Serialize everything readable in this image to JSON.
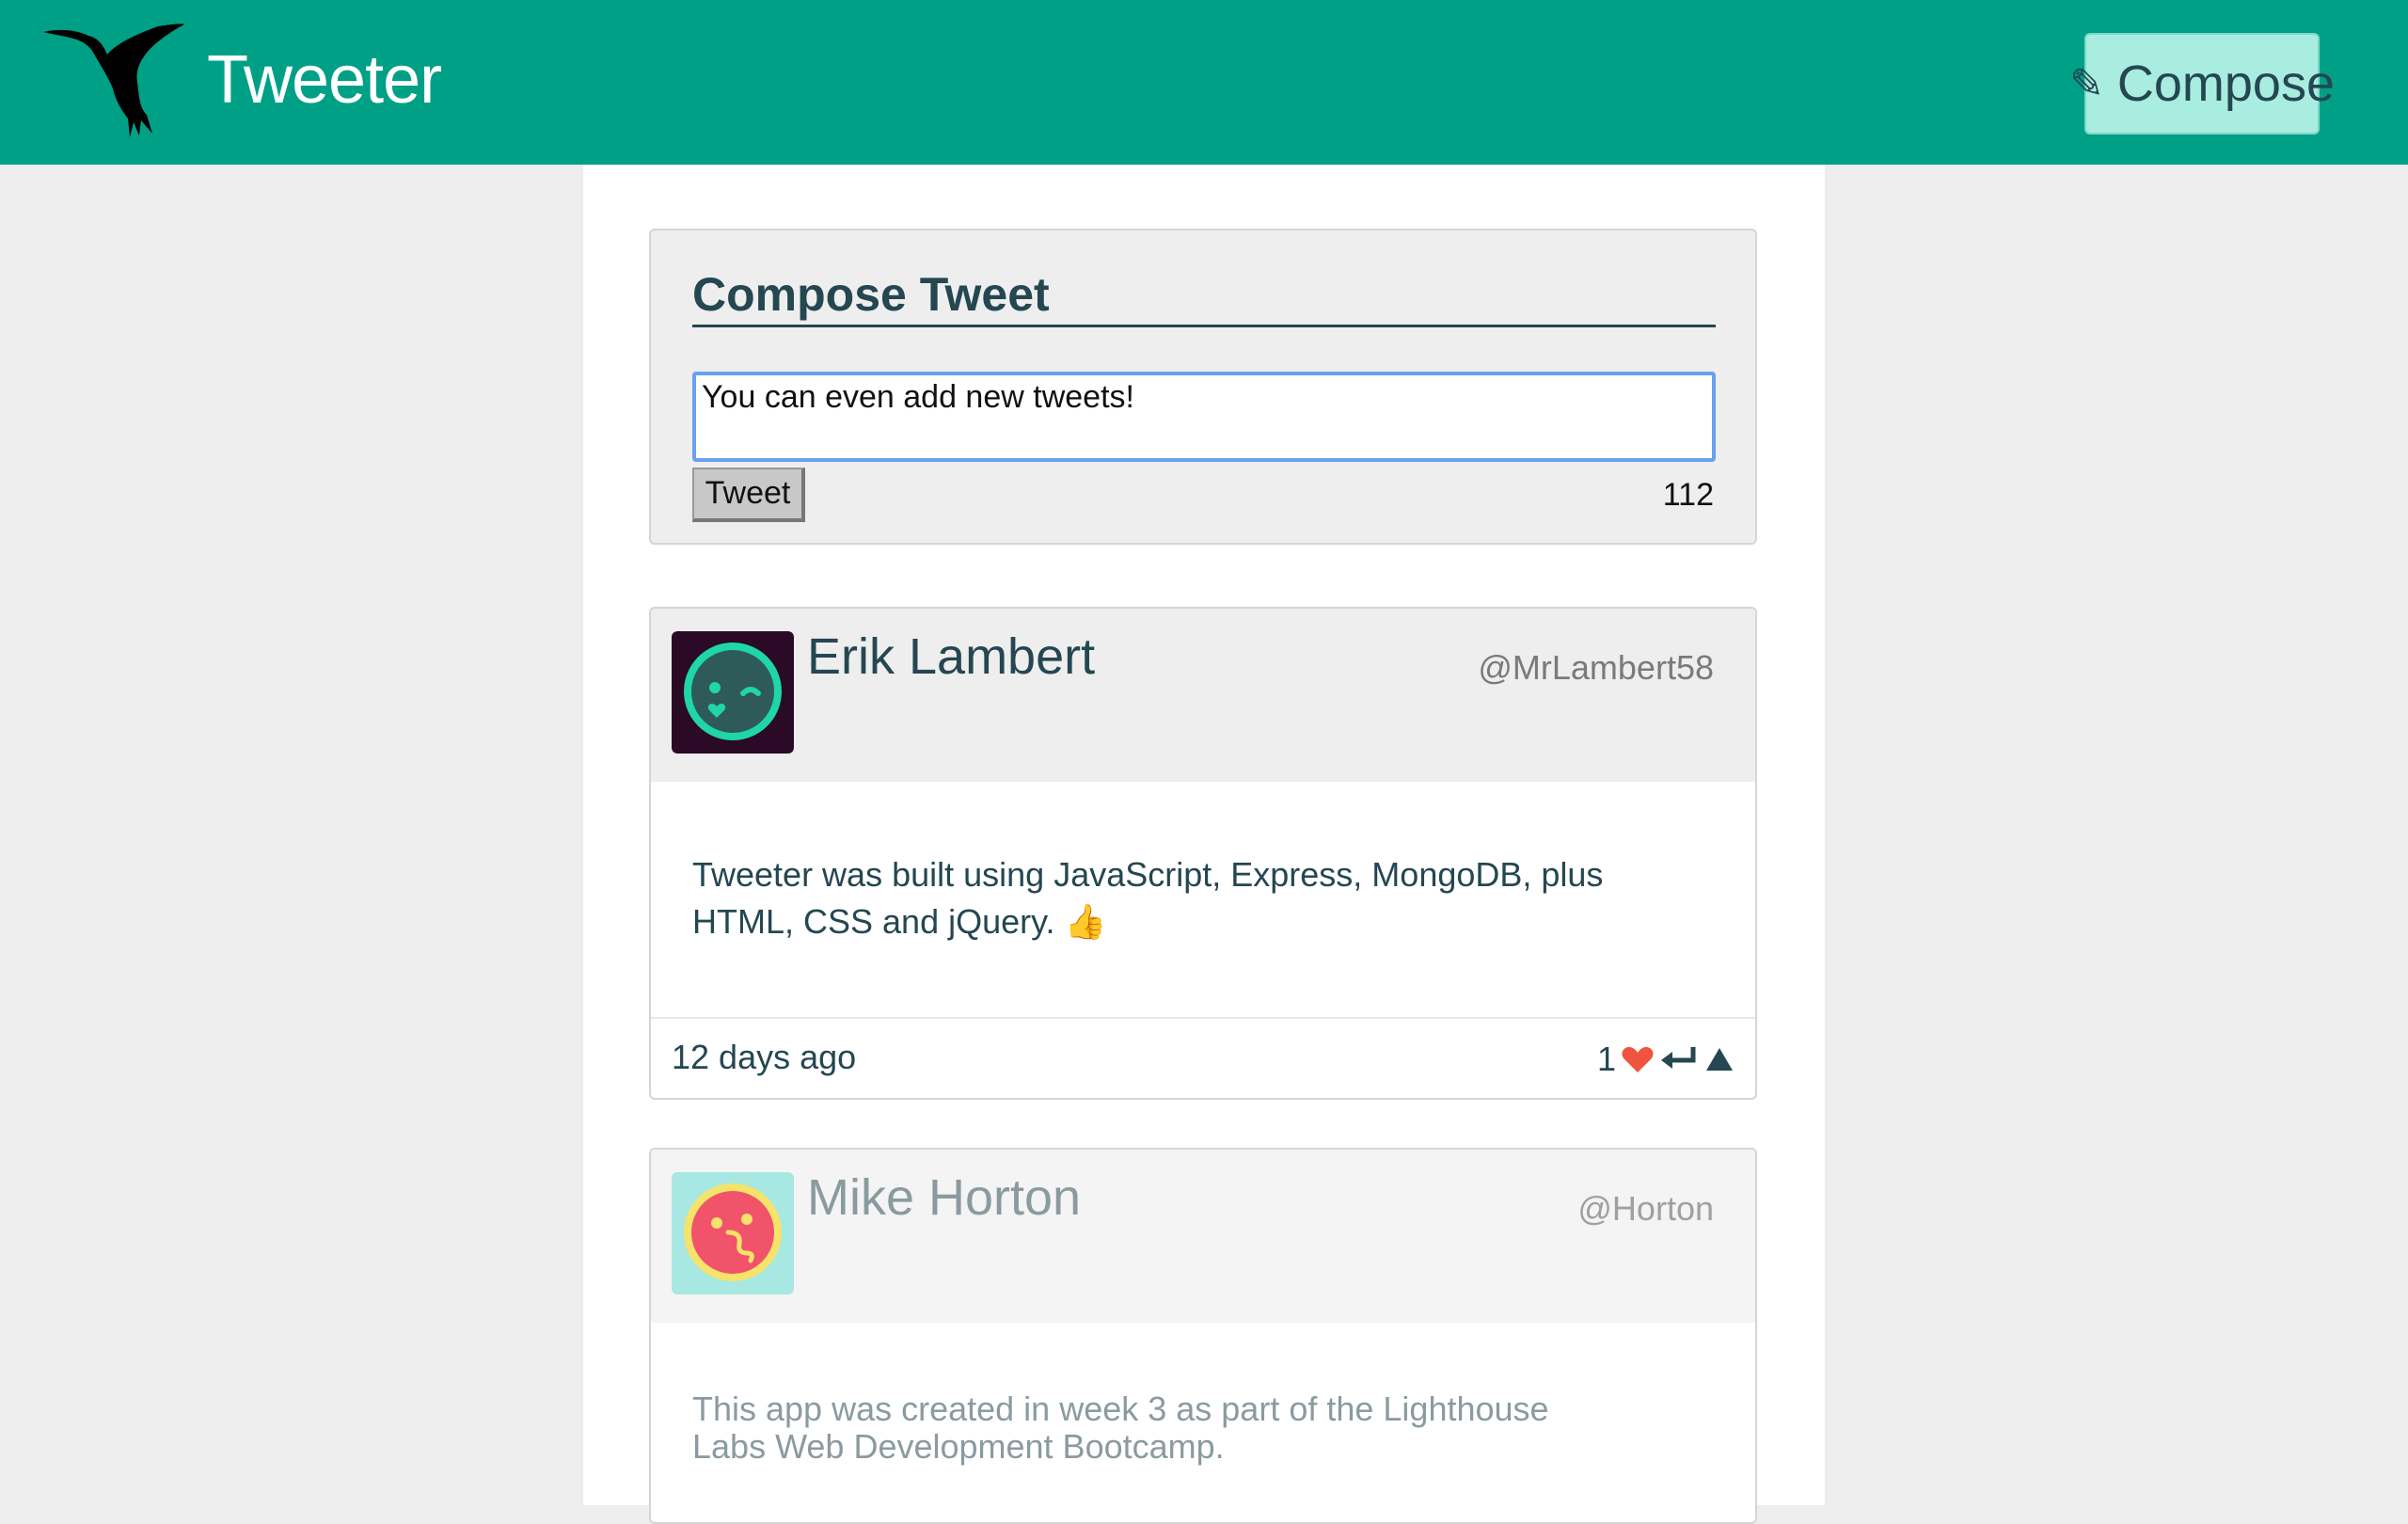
{
  "app": {
    "title": "Tweeter"
  },
  "nav": {
    "compose_label": "Compose",
    "compose_icon": "pencil-icon"
  },
  "compose": {
    "title": "Compose Tweet",
    "input_value": "You can even add new tweets!",
    "button_label": "Tweet",
    "counter": "112"
  },
  "tweets": [
    {
      "name": "Erik Lambert",
      "handle": "@MrLambert58",
      "text": "Tweeter was built using JavaScript, Express, MongoDB, plus HTML, CSS and jQuery. 👍",
      "date": "12 days ago",
      "likes": "1",
      "avatar_colors": {
        "bg": "#2a0a26",
        "face": "#2f5a5a",
        "ring": "#1fd6a8"
      }
    },
    {
      "name": "Mike Horton",
      "handle": "@Horton",
      "text": "This app was created in week 3 as part of the Lighthouse Labs Web Development Bootcamp.",
      "avatar_colors": {
        "bg": "#a8e8e2",
        "face": "#f0536a",
        "ring": "#f6e36a"
      }
    }
  ],
  "colors": {
    "brand": "#00a087",
    "text": "#244751",
    "heart": "#f0533f"
  }
}
